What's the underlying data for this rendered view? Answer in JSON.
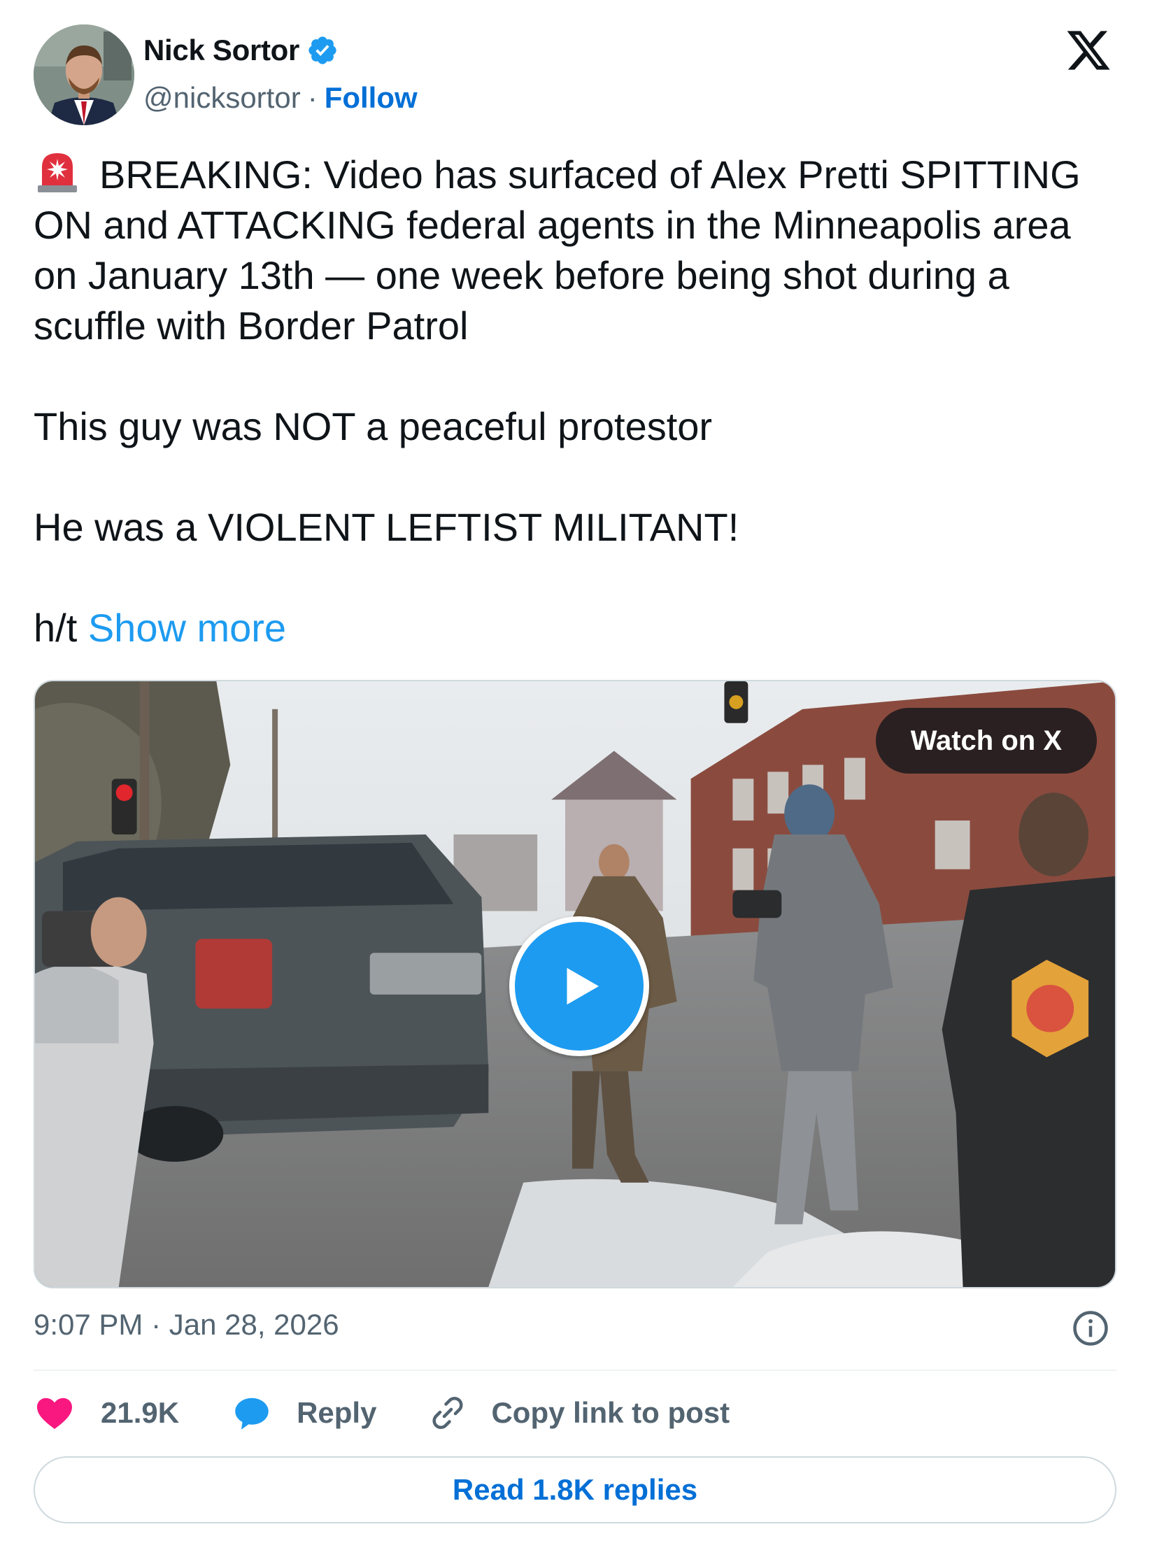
{
  "author": {
    "name": "Nick Sortor",
    "handle": "@nicksortor",
    "separator": "·",
    "follow_label": "Follow",
    "verified_color": "#1d9bf0"
  },
  "tweet": {
    "paragraph1": "BREAKING: Video has surfaced of Alex Pretti SPITTING ON and ATTACKING federal agents in the Minneapolis area on January 13th — one week before being shot during a scuffle with Border Patrol",
    "paragraph2": "This guy was NOT a peaceful protestor",
    "paragraph3": "He was a VIOLENT LEFTIST MILITANT!",
    "paragraph4_prefix": "h/t ",
    "show_more_label": "Show more",
    "emoji_icon": "police-siren-icon"
  },
  "media": {
    "watch_label": "Watch on X",
    "play_icon": "play-icon"
  },
  "footer": {
    "timestamp": "9:07 PM · Jan 28, 2026",
    "likes_count": "21.9K",
    "reply_label": "Reply",
    "copy_label": "Copy link to post",
    "read_replies_label": "Read 1.8K replies"
  },
  "colors": {
    "like": "#f91880",
    "reply": "#1d9bf0",
    "link": "#006fd6",
    "show_more": "#1d9bf0"
  }
}
